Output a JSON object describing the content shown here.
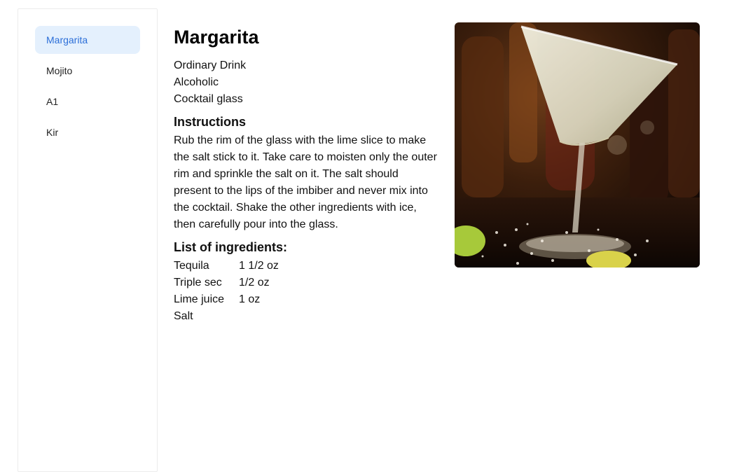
{
  "sidebar": {
    "items": [
      {
        "label": "Margarita"
      },
      {
        "label": "Mojito"
      },
      {
        "label": "A1"
      },
      {
        "label": "Kir"
      }
    ],
    "active_index": 0
  },
  "drink": {
    "name": "Margarita",
    "category": "Ordinary Drink",
    "alcoholic": "Alcoholic",
    "glass": "Cocktail glass",
    "instructions_heading": "Instructions",
    "instructions": "Rub the rim of the glass with the lime slice to make the salt stick to it. Take care to moisten only the outer rim and sprinkle the salt on it. The salt should present to the lips of the imbiber and never mix into the cocktail. Shake the other ingredients with ice, then carefully pour into the glass.",
    "ingredients_heading": "List of ingredients:",
    "ingredients": [
      {
        "name": "Tequila",
        "measure": "1 1/2 oz"
      },
      {
        "name": "Triple sec",
        "measure": "1/2 oz"
      },
      {
        "name": "Lime juice",
        "measure": "1 oz"
      },
      {
        "name": "Salt",
        "measure": ""
      }
    ]
  },
  "colors": {
    "accent": "#2c6fd8",
    "active_bg": "#e4f0fd"
  }
}
